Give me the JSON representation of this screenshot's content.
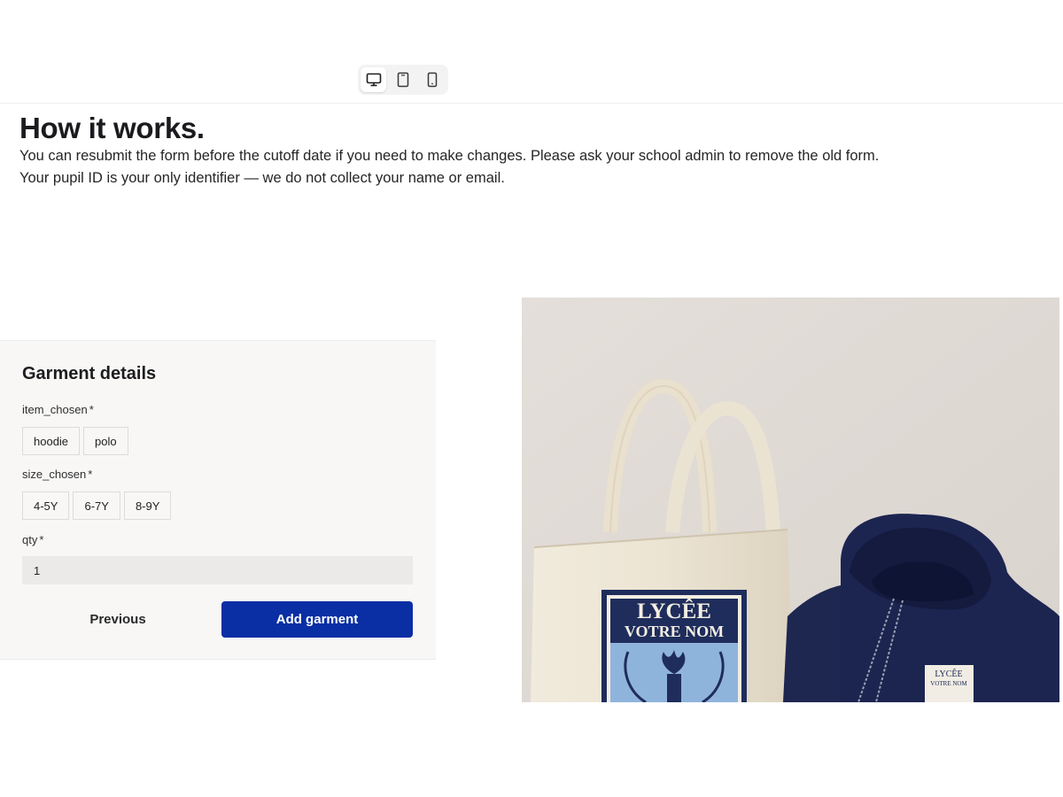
{
  "toolbar": {
    "devices": [
      {
        "name": "desktop",
        "icon": "monitor-icon",
        "active": true
      },
      {
        "name": "tablet",
        "icon": "tablet-icon",
        "active": false
      },
      {
        "name": "mobile",
        "icon": "phone-icon",
        "active": false
      }
    ]
  },
  "intro": {
    "title": "How it works.",
    "line1": "You can resubmit the form before the cutoff date if you need to make changes. Please ask your school admin to remove the old form.",
    "line2": "Your pupil ID is your only identifier — we do not collect your name or email."
  },
  "form": {
    "title": "Garment details",
    "fields": {
      "item": {
        "label": "item_chosen",
        "required_mark": "*",
        "options": [
          "hoodie",
          "polo"
        ]
      },
      "size": {
        "label": "size_chosen",
        "required_mark": "*",
        "options": [
          "4-5Y",
          "6-7Y",
          "8-9Y"
        ]
      },
      "qty": {
        "label": "qty",
        "required_mark": "*",
        "value": "1"
      }
    },
    "previous_label": "Previous",
    "submit_label": "Add garment"
  },
  "image": {
    "description_icon": "tote-bag-and-hoodie-image",
    "bag_text_line1": "LYCÊE",
    "bag_text_line2": "VOTRE NOM",
    "hoodie_text_line1": "LYCÊE",
    "hoodie_text_line2": "VOTRE NOM"
  },
  "colors": {
    "accent": "#0a2ea4",
    "panel_bg": "#f8f7f6",
    "navy": "#1c2752"
  }
}
